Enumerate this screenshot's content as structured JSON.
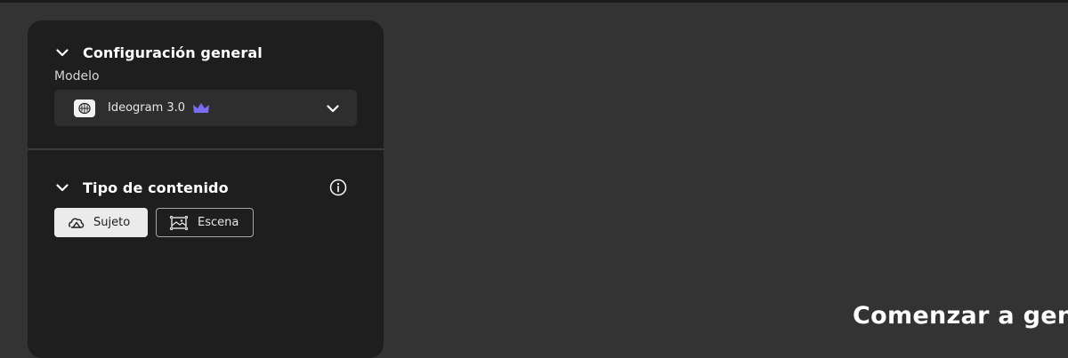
{
  "general_config": {
    "title": "Configuración general",
    "model_label": "Modelo",
    "model": {
      "name": "Ideogram 3.0",
      "premium_icon": "crown-icon",
      "premium_color": "#7b6cf6"
    }
  },
  "content_type": {
    "title": "Tipo de contenido",
    "options": [
      {
        "label": "Sujeto",
        "icon": "subject-shape-icon",
        "selected": true
      },
      {
        "label": "Escena",
        "icon": "scene-image-icon",
        "selected": false
      }
    ]
  },
  "main": {
    "heading": "Comenzar a gen"
  },
  "colors": {
    "background": "#333333",
    "panel": "#1e1e1e",
    "accent": "#7b6cf6"
  }
}
